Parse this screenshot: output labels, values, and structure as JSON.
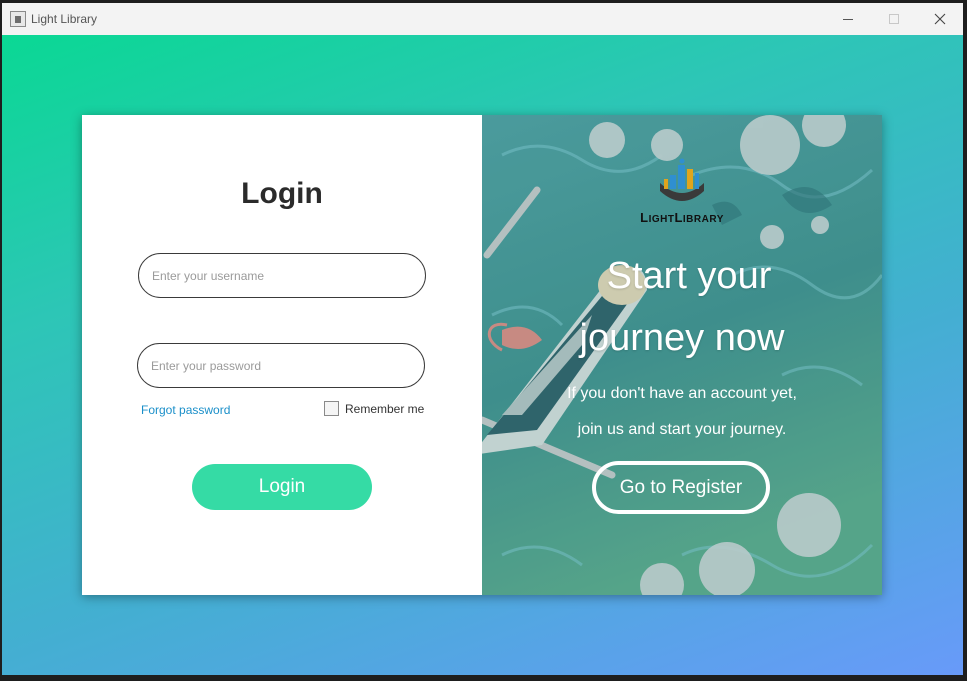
{
  "window": {
    "title": "Light Library",
    "controls": [
      "minimize-icon",
      "maximize-icon",
      "close-icon"
    ]
  },
  "theme": {
    "gradient_start": "#0ad894",
    "gradient_end": "#689af9",
    "login_button": "#35dba5",
    "link": "#1a8fc9"
  },
  "login": {
    "title": "Login",
    "username_placeholder": "Enter your username",
    "password_placeholder": "Enter your password",
    "forgot_label": "Forgot password",
    "remember_label": "Remember me",
    "remember_checked": false,
    "button_label": "Login"
  },
  "promo": {
    "brand_first": "L",
    "brand_first_rest": "IGHT",
    "brand_second": "L",
    "brand_second_rest": "IBRARY",
    "headline_line1": "Start your",
    "headline_line2": "journey now",
    "sub_line1": "If you don't have an account yet,",
    "sub_line2": "join us and start your journey.",
    "register_label": "Go to Register"
  }
}
